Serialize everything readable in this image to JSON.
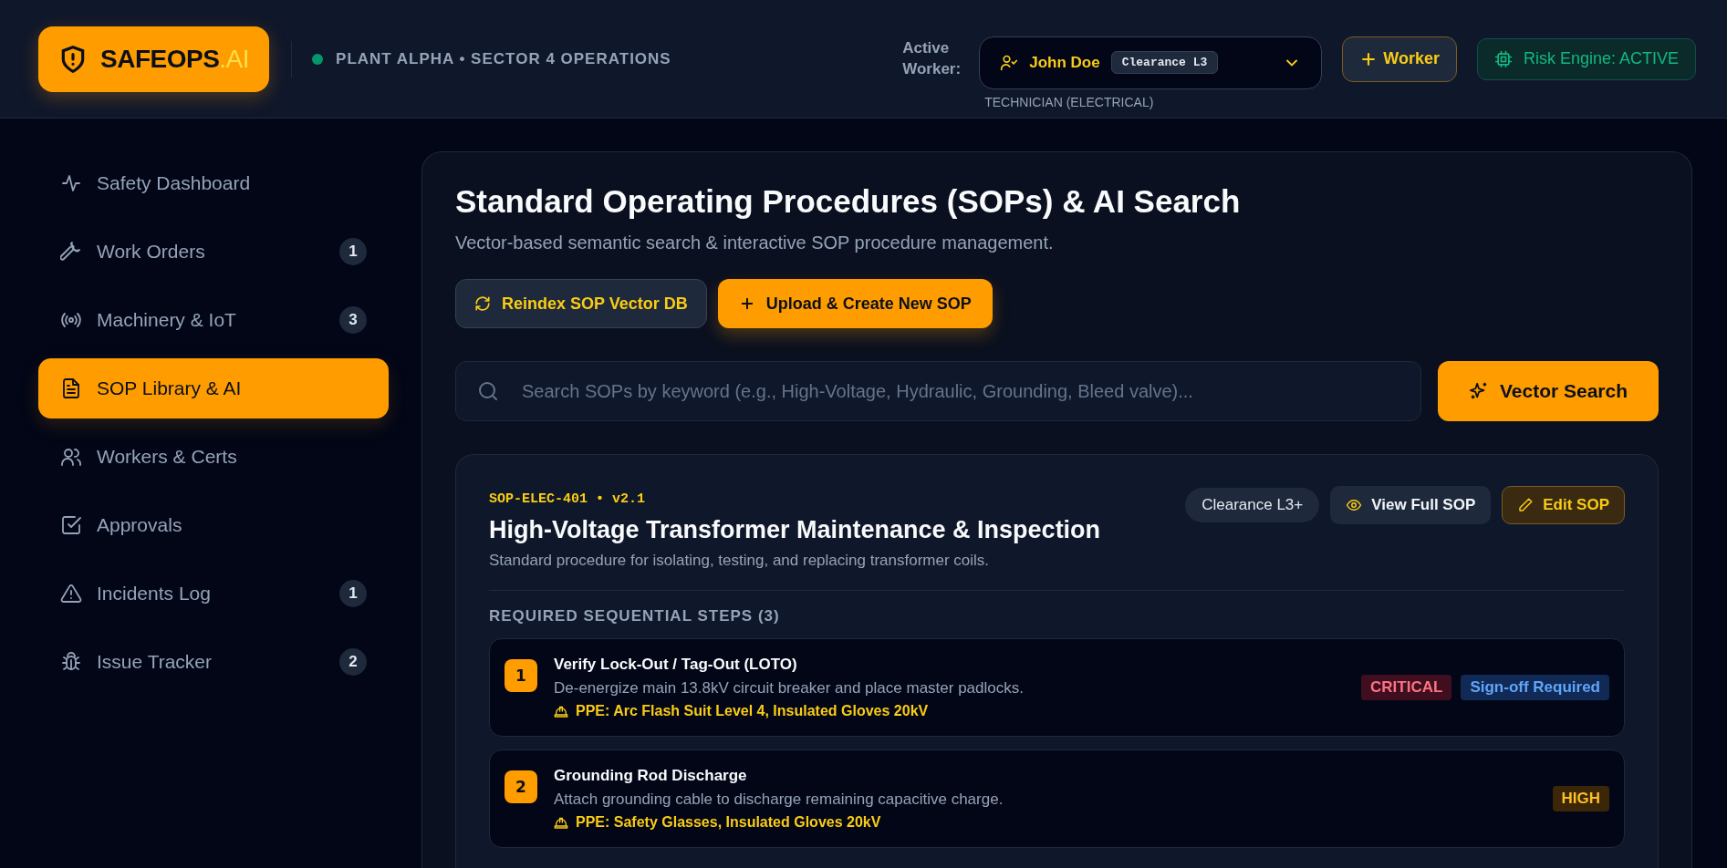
{
  "brand": {
    "name": "SAFEOPS",
    "suffix": ".AI"
  },
  "location": "PLANT ALPHA • SECTOR 4 OPERATIONS",
  "worker": {
    "label": "Active Worker:",
    "name": "John Doe",
    "clearance": "Clearance L3",
    "role": "TECHNICIAN (ELECTRICAL)"
  },
  "add_worker_button": "Worker",
  "risk_engine": "Risk Engine: ACTIVE",
  "sidebar": {
    "items": [
      {
        "label": "Safety Dashboard",
        "selected": false
      },
      {
        "label": "Work Orders",
        "badge": "1",
        "selected": false
      },
      {
        "label": "Machinery & IoT",
        "badge": "3",
        "selected": false
      },
      {
        "label": "SOP Library & AI",
        "selected": true
      },
      {
        "label": "Workers & Certs",
        "selected": false
      },
      {
        "label": "Approvals",
        "selected": false
      },
      {
        "label": "Incidents Log",
        "badge": "1",
        "selected": false
      },
      {
        "label": "Issue Tracker",
        "badge": "2",
        "selected": false
      }
    ]
  },
  "page": {
    "title": "Standard Operating Procedures (SOPs) & AI Search",
    "subtitle": "Vector-based semantic search & interactive SOP procedure management.",
    "buttons": [
      {
        "label": "Reindex SOP Vector DB",
        "kind": "secondary"
      },
      {
        "label": "Upload & Create New SOP",
        "kind": "primary"
      }
    ],
    "search": {
      "placeholder": "Search SOPs by keyword (e.g., High-Voltage, Hydraulic, Grounding, Bleed valve)..."
    },
    "search_button": "Vector Search"
  },
  "sop": {
    "code": "SOP-ELEC-401 • v2.1",
    "title": "High-Voltage Transformer Maintenance & Inspection",
    "description": "Standard procedure for isolating, testing, and replacing transformer coils.",
    "clearance": "Clearance L3+",
    "actions": [
      {
        "label": "View Full SOP",
        "kind": "view"
      },
      {
        "label": "Edit SOP",
        "kind": "edit"
      }
    ],
    "steps_heading": "REQUIRED SEQUENTIAL STEPS (3)",
    "steps": [
      {
        "number": "1",
        "title": "Verify Lock-Out / Tag-Out (LOTO)",
        "description": "De-energize main 13.8kV circuit breaker and place master padlocks.",
        "ppe": "PPE: Arc Flash Suit Level 4, Insulated Gloves 20kV",
        "tags": [
          {
            "label": "CRITICAL",
            "kind": "critical"
          },
          {
            "label": "Sign-off Required",
            "kind": "signoff"
          }
        ]
      },
      {
        "number": "2",
        "title": "Grounding Rod Discharge",
        "description": "Attach grounding cable to discharge remaining capacitive charge.",
        "ppe": "PPE: Safety Glasses, Insulated Gloves 20kV",
        "tags": [
          {
            "label": "HIGH",
            "kind": "high"
          }
        ]
      }
    ]
  }
}
